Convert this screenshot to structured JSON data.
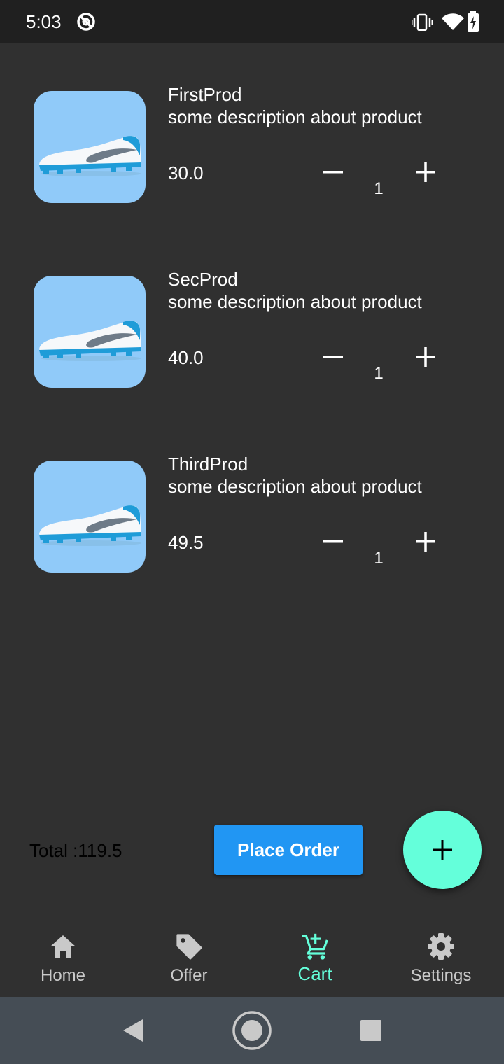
{
  "status_bar": {
    "time": "5:03",
    "icons": [
      "at-sign-icon",
      "vibrate-icon",
      "wifi-icon",
      "battery-charging-icon"
    ]
  },
  "cart": {
    "items": [
      {
        "name": "FirstProd",
        "description": "some description about product",
        "price": "30.0",
        "quantity": "1",
        "image": "shoe-image"
      },
      {
        "name": "SecProd",
        "description": "some description about product",
        "price": "40.0",
        "quantity": "1",
        "image": "shoe-image"
      },
      {
        "name": "ThirdProd",
        "description": "some description about product",
        "price": "49.5",
        "quantity": "1",
        "image": "shoe-image"
      }
    ]
  },
  "order": {
    "total_label": "Total :119.5",
    "place_order_label": "Place Order",
    "fab_icon": "plus-icon"
  },
  "bottom_nav": {
    "active": "Cart",
    "active_color": "#64ffda",
    "items": [
      {
        "label": "Home",
        "icon": "home-icon"
      },
      {
        "label": "Offer",
        "icon": "tag-icon"
      },
      {
        "label": "Cart",
        "icon": "cart-add-icon"
      },
      {
        "label": "Settings",
        "icon": "gear-icon"
      }
    ]
  },
  "system_nav": {
    "icons": [
      "back-icon",
      "home-circle-icon",
      "recents-icon"
    ]
  },
  "colors": {
    "background": "#303030",
    "status_bar": "#202020",
    "accent": "#64ffda",
    "primary_button": "#2196f3",
    "image_background": "#90caf9",
    "system_nav": "#454d55"
  }
}
